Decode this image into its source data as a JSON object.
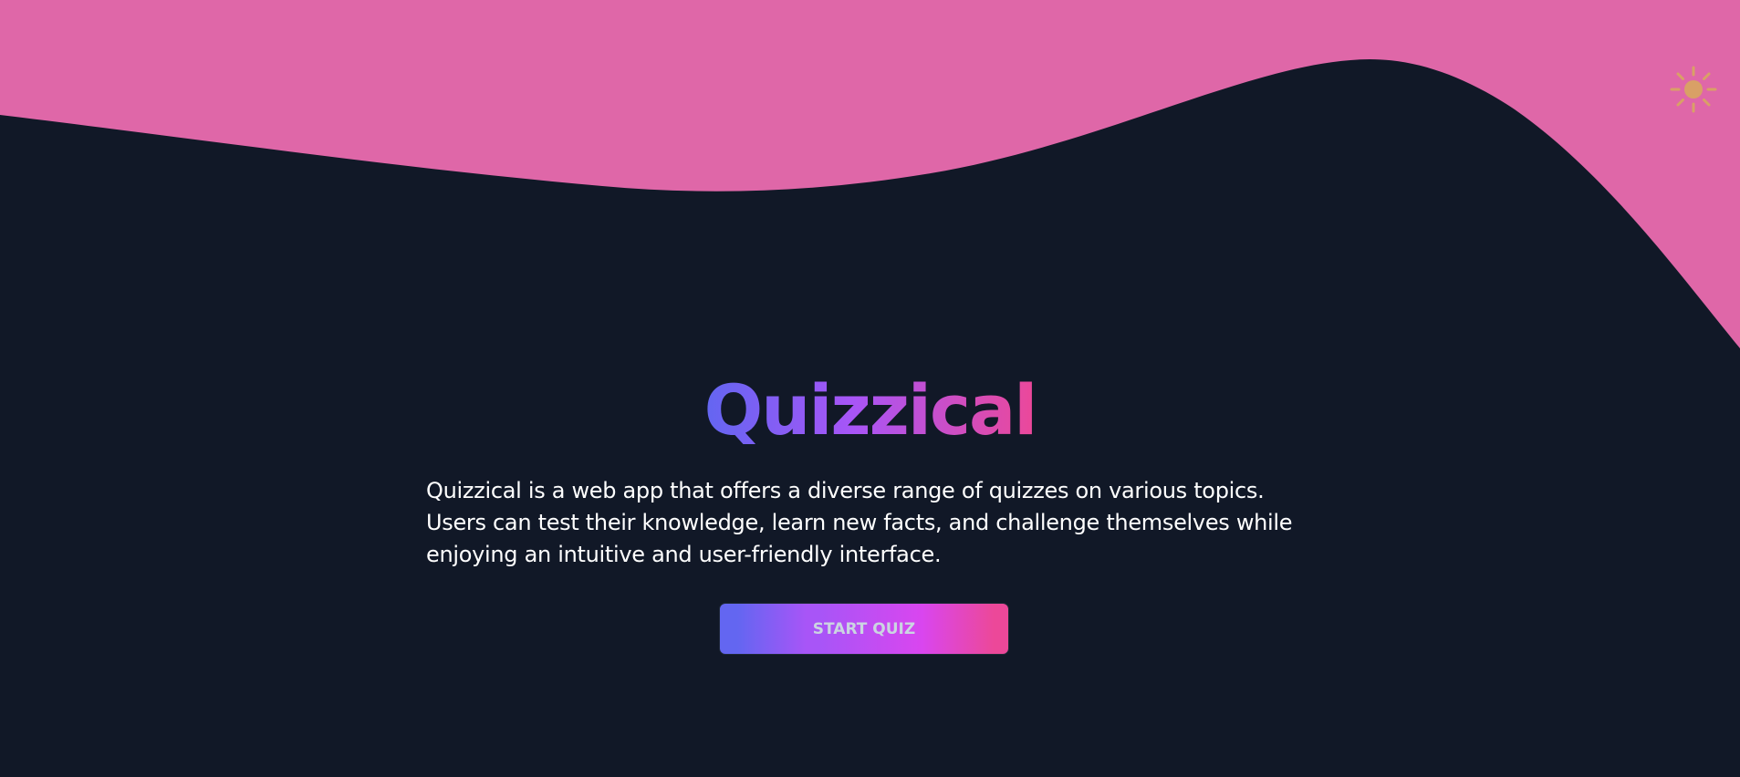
{
  "colors": {
    "background": "#111827",
    "wave": "#df67a8",
    "sun": "#d9a066",
    "gradient": [
      "#6366f1",
      "#a855f7",
      "#ec4899"
    ],
    "description_text": "#ffffff",
    "button_text": "#cbd5e1"
  },
  "header": {
    "theme_toggle_icon": "sun-icon"
  },
  "hero": {
    "title": "Quizzical",
    "description": "Quizzical is a web app that offers a diverse range of quizzes on various topics. Users can test their knowledge, learn new facts, and challenge themselves while enjoying an intuitive and user-friendly interface.",
    "start_button_label": "START QUIZ"
  }
}
